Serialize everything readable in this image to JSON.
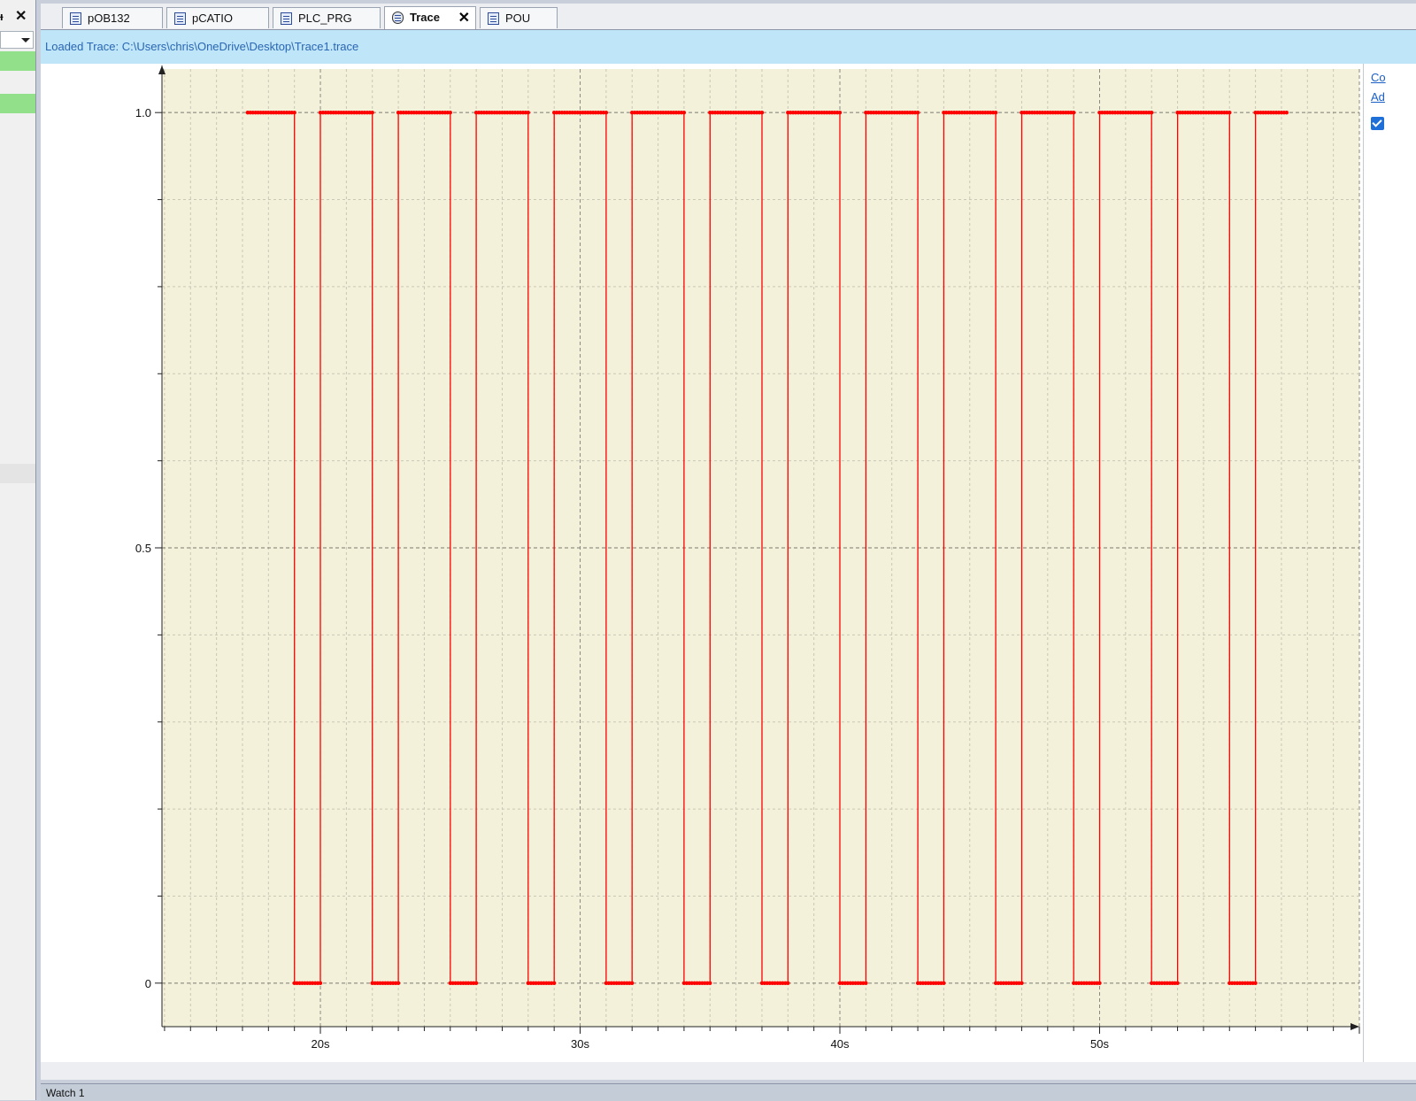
{
  "left_pane": {
    "pin_glyph": "ᵻ",
    "close_glyph": "✕"
  },
  "tabs": [
    {
      "label": "pOB132",
      "icon": "pou-icon",
      "active": false
    },
    {
      "label": "pCATIO",
      "icon": "document-icon",
      "active": false
    },
    {
      "label": "PLC_PRG",
      "icon": "document-icon",
      "active": false
    },
    {
      "label": "Trace",
      "icon": "trace-icon",
      "active": true,
      "close": "✕"
    },
    {
      "label": "POU",
      "icon": "pou-icon",
      "active": false
    }
  ],
  "info_bar": {
    "text": "Loaded Trace: C:\\Users\\chris\\OneDrive\\Desktop\\Trace1.trace"
  },
  "right_panel": {
    "link1": "Co",
    "link2": "Ad"
  },
  "bottom_bar": {
    "label": "Watch 1"
  },
  "colors": {
    "plot_bg": "#f4f1da",
    "signal": "#ff0000",
    "info_bg": "#bfe5f8",
    "accent": "#1f6fd8"
  },
  "chart_data": {
    "type": "line",
    "step": true,
    "xlabel": "",
    "ylabel": "",
    "x_ticks": [
      "20s",
      "30s",
      "40s",
      "50s"
    ],
    "y_ticks": [
      "0",
      "0.5",
      "1.0"
    ],
    "xlim": [
      13.9,
      60
    ],
    "ylim": [
      -0.05,
      1.05
    ],
    "grid": true,
    "series": [
      {
        "color": "#ff0000",
        "points": [
          [
            17.2,
            1
          ],
          [
            19.0,
            1
          ],
          [
            19.0,
            0
          ],
          [
            20.0,
            0
          ],
          [
            20.0,
            1
          ],
          [
            22.0,
            1
          ],
          [
            22.0,
            0
          ],
          [
            23.0,
            0
          ],
          [
            23.0,
            1
          ],
          [
            25.0,
            1
          ],
          [
            25.0,
            0
          ],
          [
            26.0,
            0
          ],
          [
            26.0,
            1
          ],
          [
            28.0,
            1
          ],
          [
            28.0,
            0
          ],
          [
            29.0,
            0
          ],
          [
            29.0,
            1
          ],
          [
            31.0,
            1
          ],
          [
            31.0,
            0
          ],
          [
            32.0,
            0
          ],
          [
            32.0,
            1
          ],
          [
            34.0,
            1
          ],
          [
            34.0,
            0
          ],
          [
            35.0,
            0
          ],
          [
            35.0,
            1
          ],
          [
            37.0,
            1
          ],
          [
            37.0,
            0
          ],
          [
            38.0,
            0
          ],
          [
            38.0,
            1
          ],
          [
            40.0,
            1
          ],
          [
            40.0,
            0
          ],
          [
            41.0,
            0
          ],
          [
            41.0,
            1
          ],
          [
            43.0,
            1
          ],
          [
            43.0,
            0
          ],
          [
            44.0,
            0
          ],
          [
            44.0,
            1
          ],
          [
            46.0,
            1
          ],
          [
            46.0,
            0
          ],
          [
            47.0,
            0
          ],
          [
            47.0,
            1
          ],
          [
            49.0,
            1
          ],
          [
            49.0,
            0
          ],
          [
            50.0,
            0
          ],
          [
            50.0,
            1
          ],
          [
            52.0,
            1
          ],
          [
            52.0,
            0
          ],
          [
            53.0,
            0
          ],
          [
            53.0,
            1
          ],
          [
            55.0,
            1
          ],
          [
            55.0,
            0
          ],
          [
            56.0,
            0
          ],
          [
            56.0,
            1
          ],
          [
            57.2,
            1
          ]
        ]
      }
    ]
  }
}
